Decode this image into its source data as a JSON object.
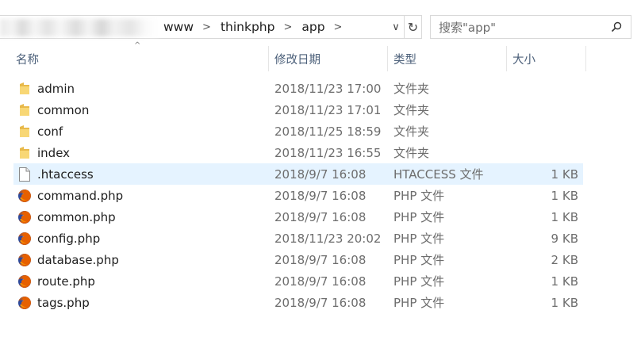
{
  "address_bar": {
    "breadcrumbs": [
      "www",
      "thinkphp",
      "app"
    ],
    "separator": ">",
    "dropdown_glyph": "∨",
    "refresh_glyph": "↻"
  },
  "search": {
    "placeholder": "搜索\"app\"",
    "icon": "search-icon"
  },
  "columns": {
    "name": "名称",
    "date": "修改日期",
    "type": "类型",
    "size": "大小",
    "sort_glyph": "^"
  },
  "colors": {
    "header_text": "#4c607a",
    "selected_row": "#e5f3ff",
    "folder": "#f8d775"
  },
  "files": [
    {
      "name": "admin",
      "date": "2018/11/23 17:00",
      "type": "文件夹",
      "size": "",
      "icon": "folder-icon"
    },
    {
      "name": "common",
      "date": "2018/11/23 17:01",
      "type": "文件夹",
      "size": "",
      "icon": "folder-icon"
    },
    {
      "name": "conf",
      "date": "2018/11/25 18:59",
      "type": "文件夹",
      "size": "",
      "icon": "folder-icon"
    },
    {
      "name": "index",
      "date": "2018/11/23 16:55",
      "type": "文件夹",
      "size": "",
      "icon": "folder-icon"
    },
    {
      "name": ".htaccess",
      "date": "2018/9/7 16:08",
      "type": "HTACCESS 文件",
      "size": "1 KB",
      "icon": "file-icon",
      "selected": true
    },
    {
      "name": "command.php",
      "date": "2018/9/7 16:08",
      "type": "PHP 文件",
      "size": "1 KB",
      "icon": "firefox-icon"
    },
    {
      "name": "common.php",
      "date": "2018/9/7 16:08",
      "type": "PHP 文件",
      "size": "1 KB",
      "icon": "firefox-icon"
    },
    {
      "name": "config.php",
      "date": "2018/11/23 20:02",
      "type": "PHP 文件",
      "size": "9 KB",
      "icon": "firefox-icon"
    },
    {
      "name": "database.php",
      "date": "2018/9/7 16:08",
      "type": "PHP 文件",
      "size": "2 KB",
      "icon": "firefox-icon"
    },
    {
      "name": "route.php",
      "date": "2018/9/7 16:08",
      "type": "PHP 文件",
      "size": "1 KB",
      "icon": "firefox-icon"
    },
    {
      "name": "tags.php",
      "date": "2018/9/7 16:08",
      "type": "PHP 文件",
      "size": "1 KB",
      "icon": "firefox-icon"
    }
  ]
}
